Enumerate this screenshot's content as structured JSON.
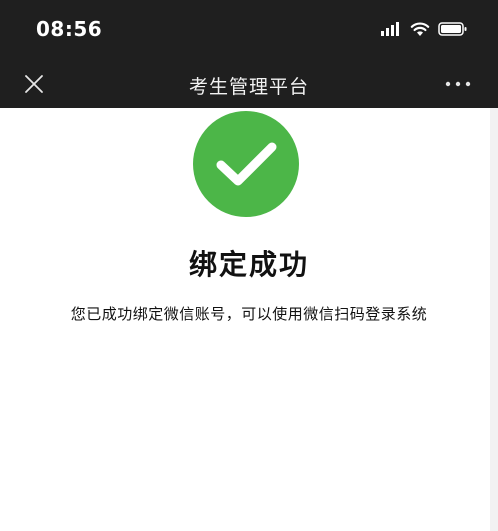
{
  "status_bar": {
    "time": "08:56",
    "icons": [
      "signal-icon",
      "wifi-icon",
      "battery-icon"
    ]
  },
  "nav": {
    "title": "考生管理平台",
    "close_icon": "close-icon",
    "more_icon": "more-icon"
  },
  "result": {
    "icon": "success-check-icon",
    "title": "绑定成功",
    "description": "您已成功绑定微信账号，可以使用微信扫码登录系统"
  },
  "colors": {
    "header_bg": "#1f1f1f",
    "success_green": "#4cb648",
    "text": "#111111",
    "background": "#ffffff"
  }
}
